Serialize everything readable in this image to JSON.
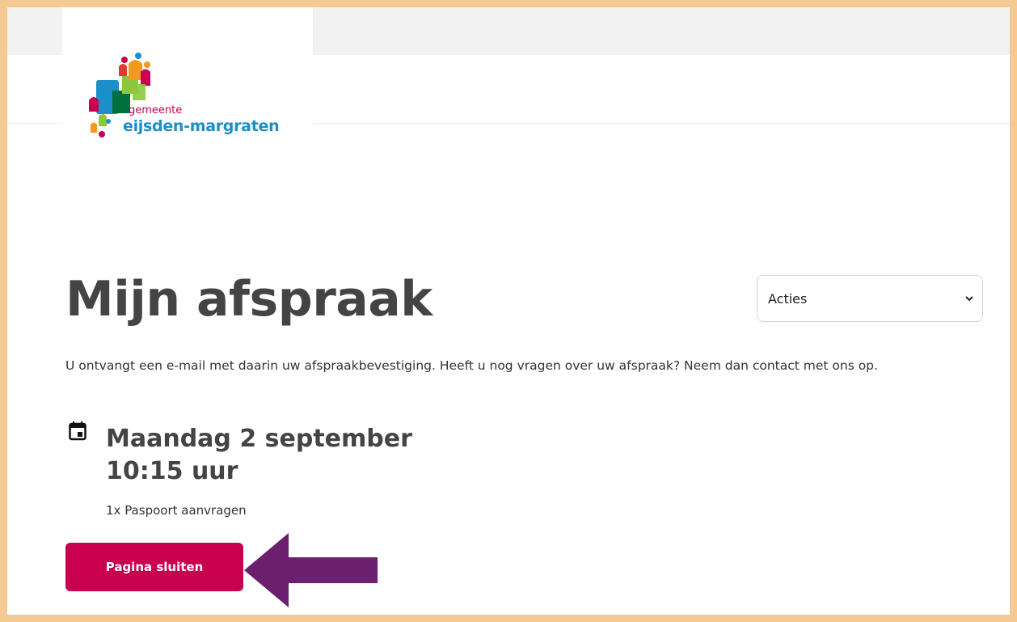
{
  "header": {
    "logo": {
      "line1": "gemeente",
      "line2": "eijsden-margraten",
      "icon": "municipality-logo-mark"
    }
  },
  "page": {
    "title": "Mijn afspraak",
    "actions_select": {
      "selected": "Acties",
      "icon": "chevron-down-icon"
    },
    "intro": "U ontvangt een e-mail met daarin uw afspraakbevestiging. Heeft u nog vragen over uw afspraak? Neem dan contact met ons op.",
    "appointment": {
      "icon": "calendar-icon",
      "date": "Maandag 2 september",
      "time": "10:15 uur",
      "service": "1x Paspoort aanvragen"
    },
    "close_button": "Pagina sluiten"
  },
  "annotation": {
    "arrow_color": "#6b1f6e",
    "accent_color": "#c8004f",
    "frame_color": "#f5c992"
  }
}
